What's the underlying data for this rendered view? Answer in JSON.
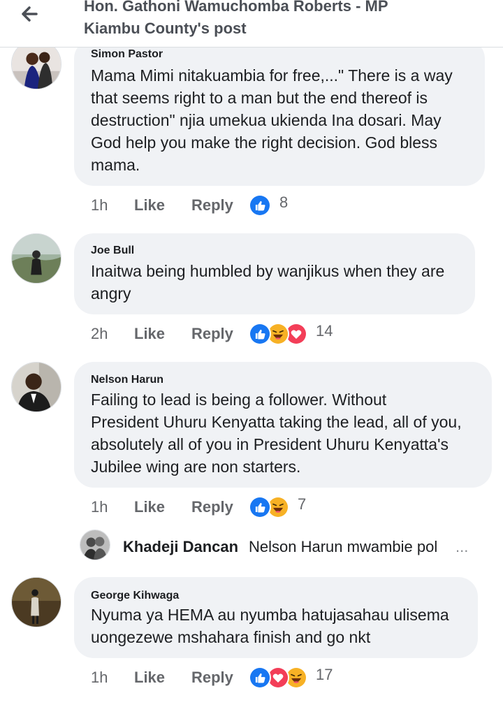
{
  "header": {
    "title_line1": "Hon. Gathoni Wamuchomba Roberts - MP",
    "title_line2": "Kiambu County's post",
    "back_icon": "arrow-left-icon"
  },
  "colors": {
    "bubble": "#f0f2f5",
    "meta_text": "#65676b",
    "like_blue": "#1877f2",
    "love_red": "#f33e58",
    "haha_yellow": "#f7b125"
  },
  "comments": [
    {
      "author": "Simon Pastor",
      "lines": [
        "Mama Mimi nitakuambia for free,...\" There is a way",
        "that seems right to a man but the end thereof is",
        "destruction\" njia umekua ukienda Ina dosari. May",
        "God help you make the right decision. God bless",
        "mama."
      ],
      "time": "1h",
      "like": "Like",
      "reply": "Reply",
      "reactions": [
        "like"
      ],
      "reaction_count": "8"
    },
    {
      "author": "Joe Bull",
      "lines": [
        "Inaitwa being humbled by wanjikus when they are",
        "angry"
      ],
      "time": "2h",
      "like": "Like",
      "reply": "Reply",
      "reactions": [
        "like",
        "haha",
        "love"
      ],
      "reaction_count": "14"
    },
    {
      "author": "Nelson Harun",
      "lines": [
        "Failing to lead is being a follower. Without",
        "President Uhuru Kenyatta taking the lead, all of you,",
        "absolutely all of you in President Uhuru Kenyatta's",
        "Jubilee wing are non starters."
      ],
      "time": "1h",
      "like": "Like",
      "reply": "Reply",
      "reactions": [
        "like",
        "haha"
      ],
      "reaction_count": "7"
    },
    {
      "author": "George Kihwaga",
      "lines": [
        "Nyuma ya HEMA au nyumba hatujasahau ulisema",
        "uongezewe mshahara finish and go nkt"
      ],
      "time": "1h",
      "like": "Like",
      "reply": "Reply",
      "reactions": [
        "like",
        "love",
        "haha"
      ],
      "reaction_count": "17"
    }
  ],
  "reply_preview": {
    "author": "Khadeji Dancan",
    "snippet": "Nelson Harun mwambie pol",
    "ellipsis": "..."
  }
}
